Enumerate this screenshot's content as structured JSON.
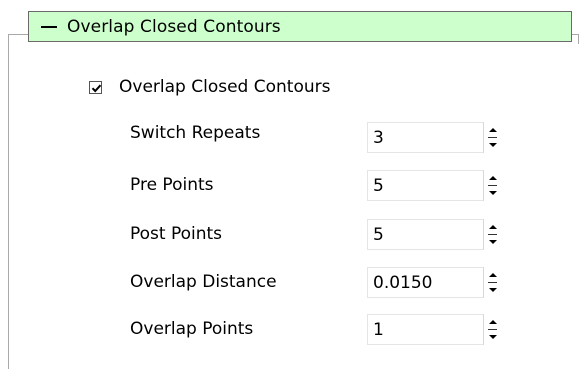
{
  "group": {
    "title": "Overlap Closed Contours",
    "header_color": "#ccffcc"
  },
  "checkbox": {
    "label": "Overlap Closed Contours",
    "checked": true
  },
  "fields": [
    {
      "label": "Switch Repeats",
      "value": "3"
    },
    {
      "label": "Pre Points",
      "value": "5"
    },
    {
      "label": "Post Points",
      "value": "5"
    },
    {
      "label": "Overlap Distance",
      "value": "0.0150"
    },
    {
      "label": "Overlap Points",
      "value": "1"
    }
  ]
}
